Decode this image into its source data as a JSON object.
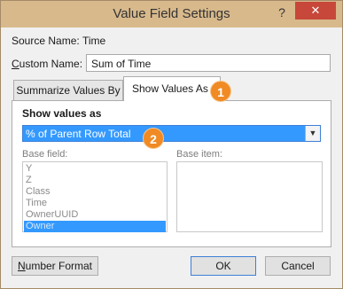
{
  "window": {
    "title": "Value Field Settings",
    "help_glyph": "?",
    "close_glyph": "✕"
  },
  "source": {
    "label": "Source Name:",
    "value": "Time"
  },
  "custom_name": {
    "label": "Custom Name:",
    "value": "Sum of Time"
  },
  "tabs": [
    {
      "label": "Summarize Values By",
      "active": false
    },
    {
      "label": "Show Values As",
      "active": true
    }
  ],
  "show_values": {
    "heading": "Show values as",
    "selected": "% of Parent Row Total",
    "base_field_label": "Base field:",
    "base_item_label": "Base item:",
    "base_fields": [
      "Y",
      "Z",
      "Class",
      "Time",
      "OwnerUUID",
      "Owner"
    ],
    "selected_base_field": "Owner"
  },
  "buttons": {
    "number_format": "Number Format",
    "ok": "OK",
    "cancel": "Cancel"
  },
  "callouts": [
    "1",
    "2"
  ],
  "colors": {
    "titlebar": "#d8b98c",
    "close": "#c7483a",
    "selection": "#3399ff",
    "callout": "#f08a24"
  }
}
